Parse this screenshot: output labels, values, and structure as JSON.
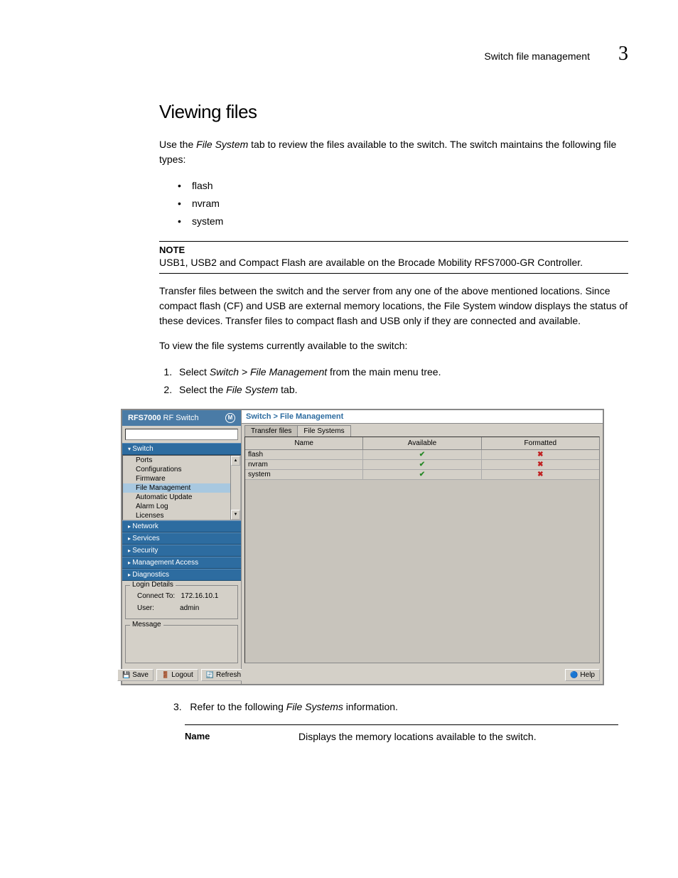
{
  "header": {
    "section": "Switch file management",
    "chapter": "3"
  },
  "title": "Viewing files",
  "intro": {
    "pre": "Use the ",
    "italic": "File System",
    "post": " tab to review the files available to the switch. The switch maintains the following file types:"
  },
  "bullets": [
    "flash",
    "nvram",
    "system"
  ],
  "note": {
    "label": "NOTE",
    "text": "USB1, USB2 and Compact Flash are available on the Brocade Mobility RFS7000-GR Controller."
  },
  "para2": "Transfer files between the switch and the server from any one of the above mentioned locations. Since compact flash (CF) and USB are external memory locations, the File System window displays the status of these devices. Transfer files to compact flash and USB only if they are connected and available.",
  "para3": "To view the file systems currently available to the switch:",
  "steps": [
    {
      "pre": "Select ",
      "italic": "Switch > File Management",
      "post": " from the main menu tree."
    },
    {
      "pre": "Select the ",
      "italic": "File System",
      "post": " tab."
    }
  ],
  "screenshot": {
    "sidebar": {
      "title_bold": "RFS7000",
      "title_rest": " RF Switch",
      "nav_open": "Switch",
      "nav_items": [
        "Ports",
        "Configurations",
        "Firmware",
        "File Management",
        "Automatic Update",
        "Alarm Log",
        "Licenses"
      ],
      "nav_selected": "File Management",
      "nav_closed": [
        "Network",
        "Services",
        "Security",
        "Management Access",
        "Diagnostics"
      ],
      "login_legend": "Login Details",
      "login_connect_label": "Connect To:",
      "login_connect_value": "172.16.10.1",
      "login_user_label": "User:",
      "login_user_value": "admin",
      "message_legend": "Message",
      "btn_save": "Save",
      "btn_logout": "Logout",
      "btn_refresh": "Refresh"
    },
    "main": {
      "breadcrumb": "Switch > File Management",
      "tabs": [
        "Transfer files",
        "File Systems"
      ],
      "active_tab": "File Systems",
      "headers": [
        "Name",
        "Available",
        "Formatted"
      ],
      "rows": [
        {
          "name": "flash",
          "available": true,
          "formatted": false
        },
        {
          "name": "nvram",
          "available": true,
          "formatted": false
        },
        {
          "name": "system",
          "available": true,
          "formatted": false
        }
      ],
      "btn_help": "Help"
    }
  },
  "step3": {
    "num": "3.",
    "pre": "Refer to the following ",
    "italic": "File Systems",
    "post": " information."
  },
  "def": {
    "label": "Name",
    "desc": "Displays the memory locations available to the switch."
  }
}
